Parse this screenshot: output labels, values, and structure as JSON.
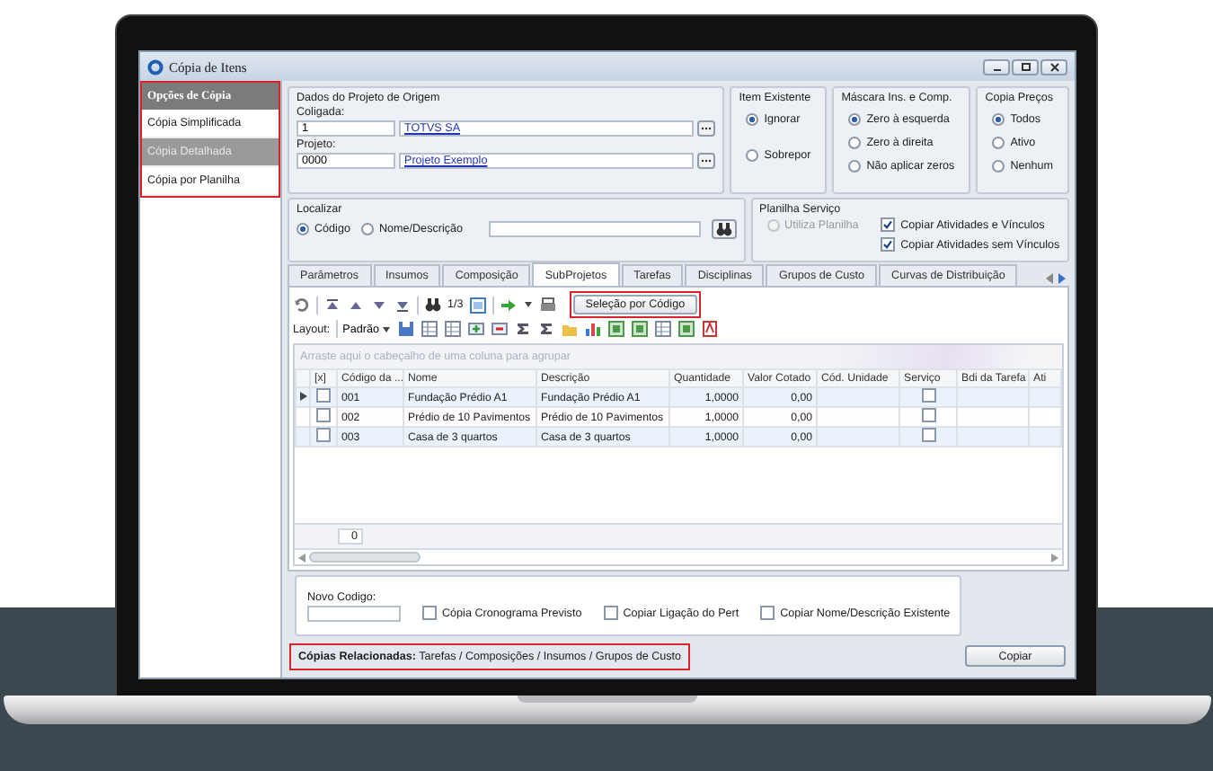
{
  "window": {
    "title": "Cópia de Itens"
  },
  "sidebar": {
    "header": "Opções de Cópia",
    "highlighted": true,
    "items": [
      {
        "label": "Cópia Simplificada",
        "selected": false
      },
      {
        "label": "Cópia Detalhada",
        "selected": true
      },
      {
        "label": "Cópia por Planilha",
        "selected": false
      }
    ]
  },
  "origin": {
    "title": "Dados do Projeto de Origem",
    "fields": [
      {
        "label": "Coligada:",
        "value": "1",
        "link": "TOTVS SA"
      },
      {
        "label": "Projeto:",
        "value": "0000",
        "link": "Projeto Exemplo"
      }
    ]
  },
  "option_groups": [
    {
      "title": "Item Existente",
      "options": [
        {
          "label": "Ignorar",
          "selected": true
        },
        {
          "label": "Sobrepor",
          "selected": false
        }
      ]
    },
    {
      "title": "Máscara Ins. e Comp.",
      "options": [
        {
          "label": "Zero à esquerda",
          "selected": true
        },
        {
          "label": "Zero à direita",
          "selected": false
        },
        {
          "label": "Não aplicar zeros",
          "selected": false
        }
      ]
    },
    {
      "title": "Copia Preços",
      "options": [
        {
          "label": "Todos",
          "selected": true
        },
        {
          "label": "Ativo",
          "selected": false
        },
        {
          "label": "Nenhum",
          "selected": false
        }
      ]
    }
  ],
  "search": {
    "title": "Localizar",
    "options": [
      {
        "label": "Código",
        "selected": true
      },
      {
        "label": "Nome/Descrição",
        "selected": false
      }
    ]
  },
  "service_sheet": {
    "title": "Planilha Serviço",
    "items": [
      {
        "kind": "radio",
        "label": "Utiliza Planilha",
        "selected": false,
        "disabled": true
      },
      {
        "kind": "checkbox",
        "label": "Copiar Atividades e Vínculos",
        "checked": true
      },
      {
        "kind": "checkbox",
        "label": "Copiar Atividades sem Vínculos",
        "checked": true
      }
    ]
  },
  "tabs": [
    {
      "label": "Parâmetros",
      "selected": false
    },
    {
      "label": "Insumos",
      "selected": false
    },
    {
      "label": "Composição",
      "selected": false
    },
    {
      "label": "SubProjetos",
      "selected": true
    },
    {
      "label": "Tarefas",
      "selected": false
    },
    {
      "label": "Disciplinas",
      "selected": false
    },
    {
      "label": "Grupos de Custo",
      "selected": false
    },
    {
      "label": "Curvas de Distribuição",
      "selected": false
    }
  ],
  "toolbar": {
    "page": "1/3",
    "selection_button": {
      "label": "Seleção por Código",
      "highlighted": true
    }
  },
  "layout_bar": {
    "label": "Layout:",
    "preset": "Padrão"
  },
  "grid": {
    "group_hint": "Arraste aqui o cabeçalho de uma coluna para agrupar",
    "columns": [
      "[x]",
      "Código da ...",
      "Nome",
      "Descrição",
      "Quantidade",
      "Valor Cotado",
      "Cód. Unidade",
      "Serviço",
      "Bdi da Tarefa",
      "Ati"
    ],
    "rows": [
      {
        "selected": true,
        "checked": false,
        "code": "001",
        "name": "Fundação Prédio A1",
        "description": "Fundação Prédio A1",
        "quantity": "1,0000",
        "quoted_value": "0,00",
        "service": false
      },
      {
        "selected": false,
        "checked": false,
        "code": "002",
        "name": "Prédio de 10 Pavimentos",
        "description": "Prédio de 10 Pavimentos",
        "quantity": "1,0000",
        "quoted_value": "0,00",
        "service": false
      },
      {
        "selected": false,
        "checked": false,
        "code": "003",
        "name": "Casa de 3 quartos",
        "description": "Casa de 3 quartos",
        "quantity": "1,0000",
        "quoted_value": "0,00",
        "service": false
      }
    ],
    "footer": "0"
  },
  "new_code": {
    "label": "Novo Codigo:",
    "options": [
      {
        "label": "Cópia Cronograma Previsto",
        "checked": false
      },
      {
        "label": "Copiar Ligação do Pert",
        "checked": false
      },
      {
        "label": "Copiar Nome/Descrição Existente",
        "checked": false
      }
    ]
  },
  "status": {
    "related": "**Cópias Relacionadas:** Tarefas / Composições / Insumos / Grupos de Custo",
    "highlighted": true,
    "button": "Copiar"
  }
}
